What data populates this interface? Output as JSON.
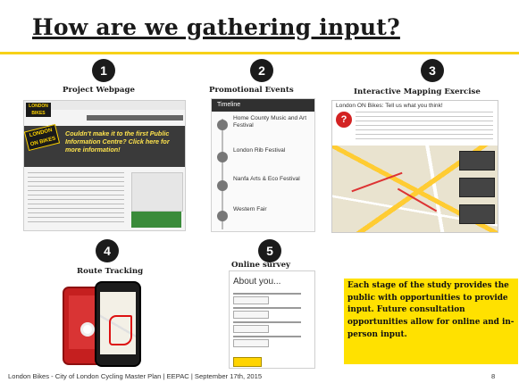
{
  "slide": {
    "title": "How are we gathering input?",
    "panels": [
      {
        "number": "1",
        "caption": "Project Webpage"
      },
      {
        "number": "2",
        "caption": "Promotional Events"
      },
      {
        "number": "3",
        "caption": "Interactive Mapping Exercise"
      },
      {
        "number": "4",
        "caption": "Route Tracking"
      },
      {
        "number": "5",
        "caption": "Online survey"
      }
    ],
    "webpage": {
      "logo": "LONDON BIKES",
      "sticker": "LONDON ON BIKES",
      "headline": "Couldn't make it to the first Public Information Centre? Click here for more information!"
    },
    "timeline": {
      "header": "Timeline",
      "events": [
        {
          "name": "Home County Music and Art Festival"
        },
        {
          "name": "London Rib Festival"
        },
        {
          "name": "Nanfa Arts & Eco Festival"
        },
        {
          "name": "Western Fair"
        }
      ]
    },
    "map": {
      "heading": "London ON Bikes: Tell us what you think!",
      "icon": "question-mark"
    },
    "survey": {
      "title": "About you..."
    },
    "callout": "Each stage of the study provides the public with opportunities to provide input. Future consultation opportunities allow for online and in-person input.",
    "footer": {
      "text": "London Bikes - City of London Cycling Master Plan | EEPAC | September 17th, 2015",
      "page": "8"
    },
    "colors": {
      "accent": "#f7d117",
      "callout": "#ffe100",
      "badge": "#1b1b1b"
    }
  }
}
